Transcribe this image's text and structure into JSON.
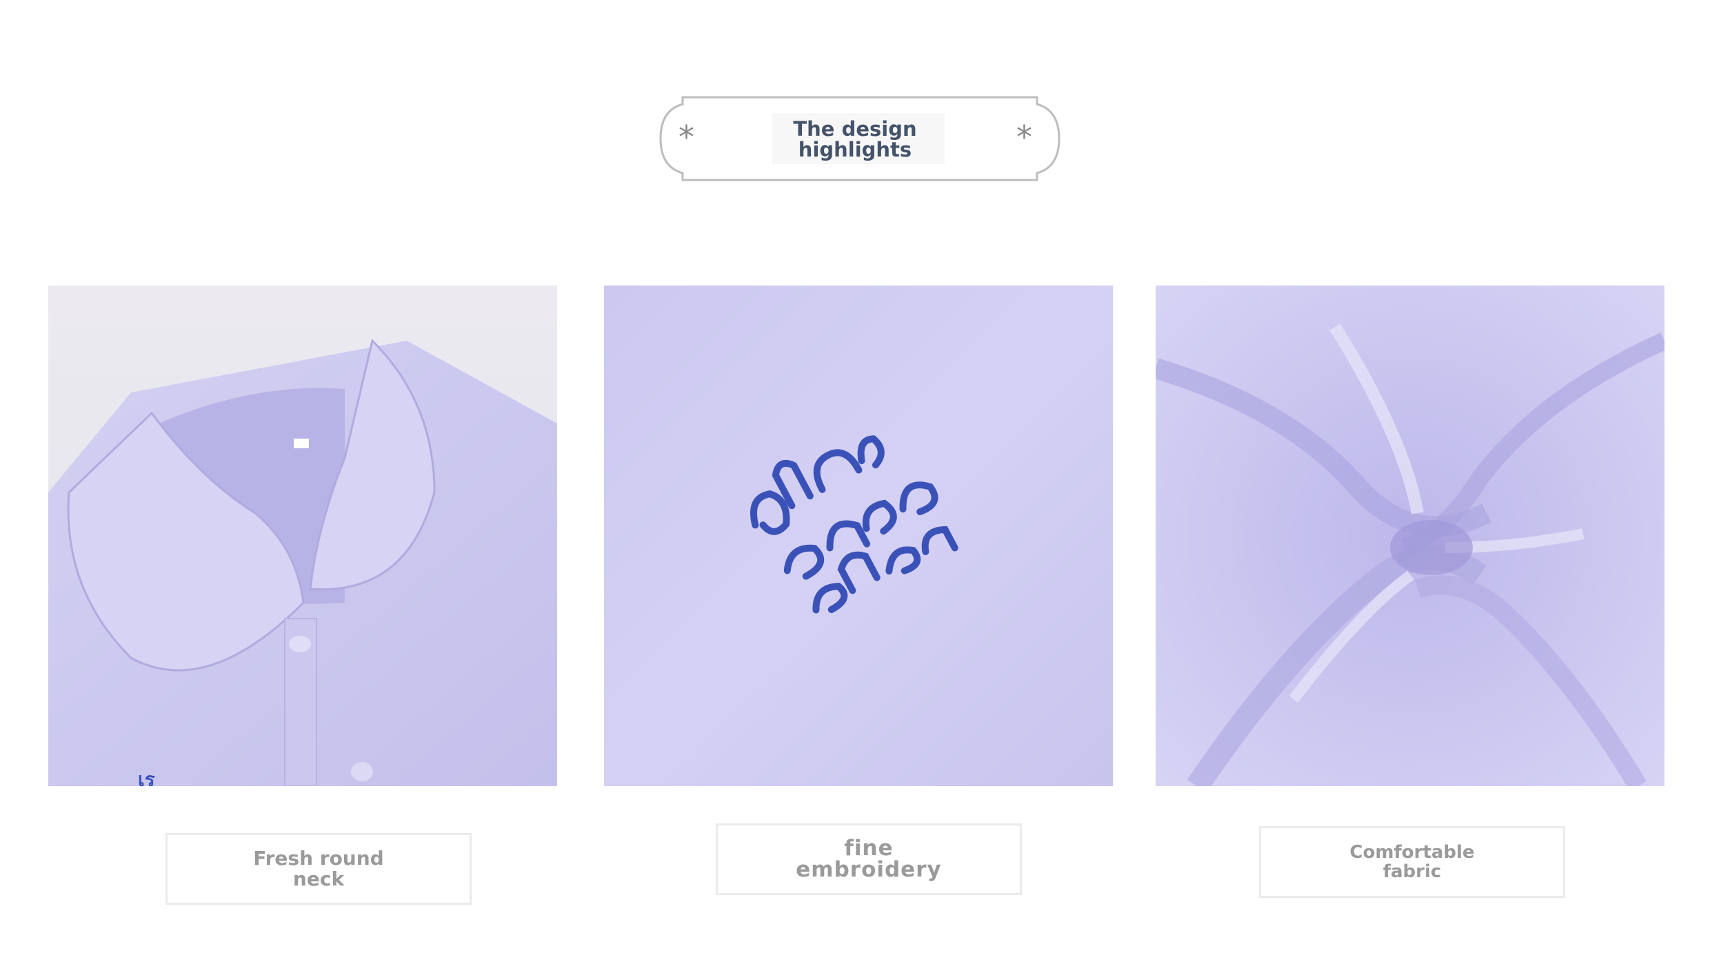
{
  "header": {
    "title_line1": "The design",
    "title_line2": "highlights",
    "star_glyph": "*"
  },
  "features": [
    {
      "caption_line1": "Fresh round",
      "caption_line2": "neck",
      "image": "round-collar-shirt-photo"
    },
    {
      "caption_line1": "fine",
      "caption_line2": "embroidery",
      "image": "blue-embroidery-closeup-photo"
    },
    {
      "caption_line1": "Comfortable",
      "caption_line2": "fabric",
      "image": "twisted-fabric-swirl-photo"
    }
  ],
  "colors": {
    "fabric_lavender": "#c9c5ee",
    "embroidery_blue": "#3a52b8",
    "title_text": "#44536a",
    "caption_text": "#9a9a9a",
    "border_gray": "#bdbdbd"
  }
}
